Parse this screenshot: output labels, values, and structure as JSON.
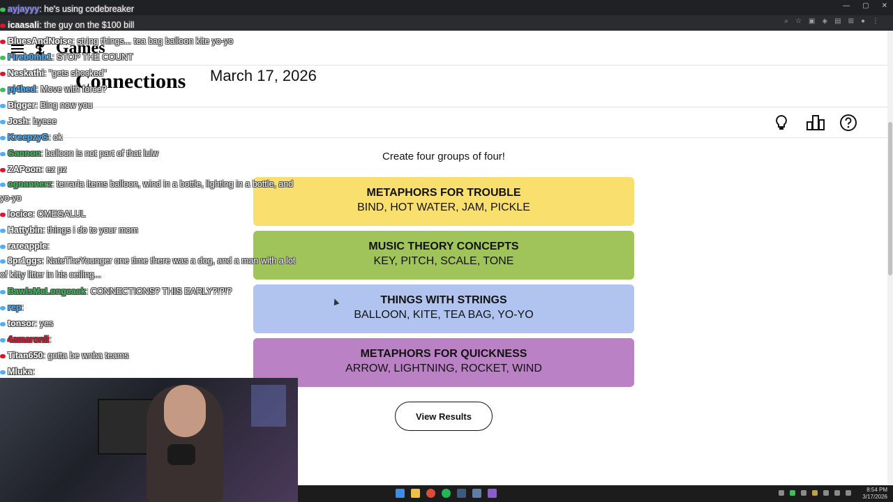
{
  "nyt": {
    "logo": "𝕿",
    "games_label": "Games",
    "title": "Connections",
    "date": "March 17, 2026"
  },
  "toolbar": {
    "hint_icon": "lightbulb-icon",
    "stats_icon": "stats-icon",
    "help_icon": "help-icon"
  },
  "instructions": "Create four groups of four!",
  "groups": [
    {
      "title": "METAPHORS FOR TROUBLE",
      "words": "BIND, HOT WATER, JAM, PICKLE",
      "color": "#f9df6d"
    },
    {
      "title": "MUSIC THEORY CONCEPTS",
      "words": "KEY, PITCH, SCALE, TONE",
      "color": "#a0c35a"
    },
    {
      "title": "THINGS WITH STRINGS",
      "words": "BALLOON, KITE, TEA BAG, YO-YO",
      "color": "#b0c4ef"
    },
    {
      "title": "METAPHORS FOR QUICKNESS",
      "words": "ARROW, LIGHTNING, ROCKET, WIND",
      "color": "#ba81c5"
    }
  ],
  "results_button": "View Results",
  "chat": [
    {
      "user": "ayjayyy",
      "msg": ": he's using codebreaker",
      "badge": "#3ac25b",
      "ucolor": "#8a8aff"
    },
    {
      "user": "icaasali",
      "msg": ": the guy on the $100 bill",
      "badge": "#e0142f",
      "ucolor": "#ffffff"
    },
    {
      "user": "BluesAndNoise",
      "msg": ": string things... tea bag balloon kite yo-yo",
      "badge": "#e0142f",
      "ucolor": "#ffffff"
    },
    {
      "user": "Fireb0mb1",
      "msg": ": STOP THE COUNT",
      "badge": "#3ac25b",
      "ucolor": "#4ab0ff"
    },
    {
      "user": "Neskathi",
      "msg": ": \"gets shocked\"",
      "badge": "#e0142f",
      "ucolor": "#ffffff"
    },
    {
      "user": "pj4hed",
      "msg": ": Move with force?",
      "badge": "#3ac25b",
      "ucolor": "#4ab0ff"
    },
    {
      "user": "Bigger",
      "msg": ": Bing now you",
      "badge": "#4ab0ff",
      "ucolor": "#ffffff"
    },
    {
      "user": "Josh",
      "msg": ": byeee",
      "badge": "#4ab0ff",
      "ucolor": "#ffffff"
    },
    {
      "user": "KreepzyG",
      "msg": ": ok",
      "badge": "#4ab0ff",
      "ucolor": "#4ab0ff"
    },
    {
      "user": "Gannon",
      "msg": ": balloon is not part of that lulw",
      "badge": "#4ab0ff",
      "ucolor": "#3ac25b"
    },
    {
      "user": "ZAPoon",
      "msg": ": ez pz",
      "badge": "#e0142f",
      "ucolor": "#ffffff"
    },
    {
      "user": "ognannerz",
      "msg": ": terraria items balloon, wind in a bottle, lighting in a bottle, and yo-yo",
      "badge": "#4ab0ff",
      "ucolor": "#3ac25b"
    },
    {
      "user": "locice",
      "msg": ": OMEGALUL",
      "badge": "#e0142f",
      "ucolor": "#ffffff"
    },
    {
      "user": "Hattybin",
      "msg": ": things i do to your mom",
      "badge": "#4ab0ff",
      "ucolor": "#ffffff"
    },
    {
      "user": "rareapple",
      "msg": ":",
      "badge": "#4ab0ff",
      "ucolor": "#ffffff"
    },
    {
      "user": "8pr1ggs",
      "msg": ": NateTheYounger one time there was a dog, and a man with a lot of kitty litter in his ceiling...",
      "badge": "#4ab0ff",
      "ucolor": "#ffffff"
    },
    {
      "user": "BawlsMcLongcack",
      "msg": ": CONNECTIONS? THIS EARLY?!?!?",
      "badge": "#4ab0ff",
      "ucolor": "#3ac25b"
    },
    {
      "user": "rep",
      "msg": ":",
      "badge": "#4ab0ff",
      "ucolor": "#4ab0ff"
    },
    {
      "user": "tonsor",
      "msg": ": yes",
      "badge": "#4ab0ff",
      "ucolor": "#ffffff"
    },
    {
      "user": "4amaronli",
      "msg": ":",
      "badge": "#4ab0ff",
      "ucolor": "#e0142f"
    },
    {
      "user": "Titan650",
      "msg": ": gotta be wnba teams",
      "badge": "#e0142f",
      "ucolor": "#ffffff"
    },
    {
      "user": "Mluka",
      "msg": ":",
      "badge": "#4ab0ff",
      "ucolor": "#ffffff"
    }
  ],
  "taskbar": {
    "clock_time": "8:54 PM",
    "clock_date": "3/17/2026"
  }
}
